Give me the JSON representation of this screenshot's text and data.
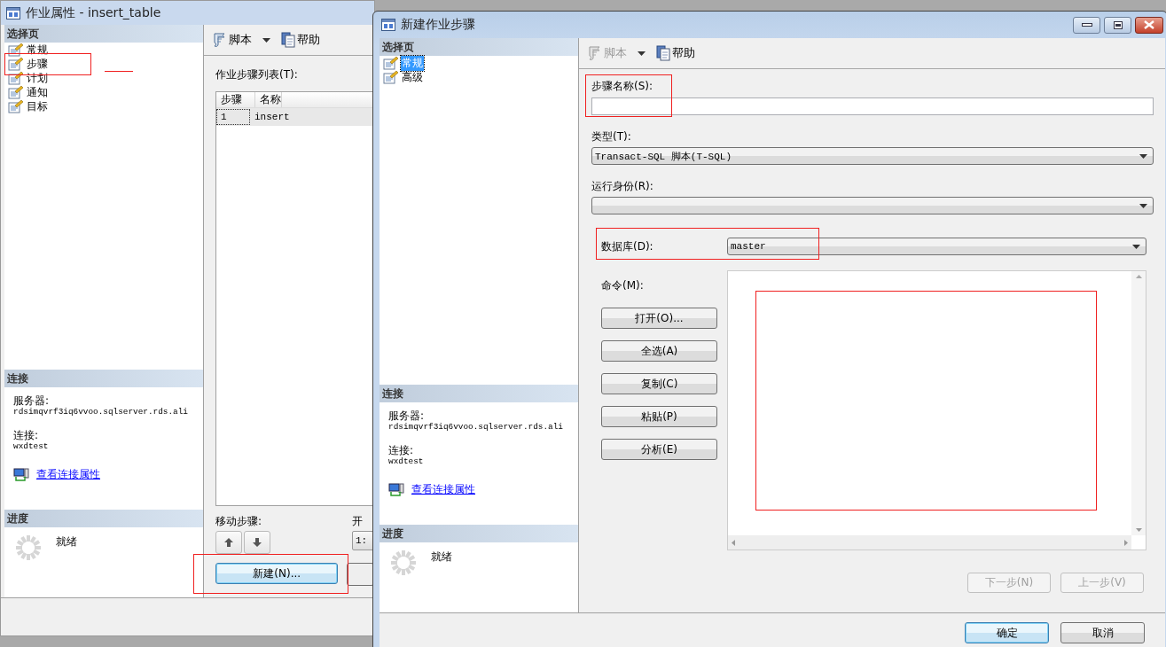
{
  "back_window": {
    "title": "作业属性 - insert_table",
    "sidebar": {
      "header": "选择页",
      "items": [
        {
          "label": "常规",
          "selected": false
        },
        {
          "label": "步骤",
          "selected": false
        },
        {
          "label": "计划",
          "selected": false
        },
        {
          "label": "通知",
          "selected": false
        },
        {
          "label": "目标",
          "selected": false
        }
      ]
    },
    "connection": {
      "header": "连接",
      "server_label": "服务器:",
      "server": "rdsimqvrf3iq6vvoo.sqlserver.rds.ali",
      "login_label": "连接:",
      "login": "wxdtest",
      "link": "查看连接属性"
    },
    "progress": {
      "header": "进度",
      "status": "就绪"
    },
    "toolbar": {
      "script": {
        "label": "脚本",
        "disabled": false
      },
      "help": "帮助"
    },
    "steps_label": "作业步骤列表(T):",
    "table": {
      "columns": [
        "步骤",
        "名称"
      ],
      "rows": [
        {
          "cells": [
            "1",
            "insert"
          ],
          "selected": true
        }
      ]
    },
    "move_label": "移动步骤:",
    "start_label": "开",
    "start_value": "1:",
    "new_button": {
      "label": "新建(N)...",
      "default": true
    }
  },
  "dialog": {
    "title": "新建作业步骤",
    "sidebar": {
      "header": "选择页",
      "items": [
        {
          "label": "常规",
          "selected": true
        },
        {
          "label": "高级",
          "selected": false
        }
      ]
    },
    "connection": {
      "header": "连接",
      "server_label": "服务器:",
      "server": "rdsimqvrf3iq6vvoo.sqlserver.rds.ali",
      "login_label": "连接:",
      "login": "wxdtest",
      "link": "查看连接属性"
    },
    "progress": {
      "header": "进度",
      "status": "就绪"
    },
    "toolbar": {
      "script": {
        "label": "脚本",
        "disabled": true
      },
      "help": "帮助"
    },
    "step_name": {
      "label": "步骤名称(S):"
    },
    "type": {
      "label": "类型(T):",
      "value": "Transact-SQL 脚本(T-SQL)"
    },
    "run_as": {
      "label": "运行身份(R):"
    },
    "database": {
      "label": "数据库(D):",
      "value": "master"
    },
    "command": {
      "label": "命令(M):",
      "buttons": [
        "打开(O)...",
        "全选(A)",
        "复制(C)",
        "粘贴(P)",
        "分析(E)"
      ]
    },
    "nav_buttons": [
      {
        "label": "下一步(N)",
        "disabled": true
      },
      {
        "label": "上一步(V)",
        "disabled": true
      }
    ],
    "footer_buttons": [
      {
        "label": "确定",
        "default": true
      },
      {
        "label": "取消",
        "default": false
      }
    ]
  }
}
